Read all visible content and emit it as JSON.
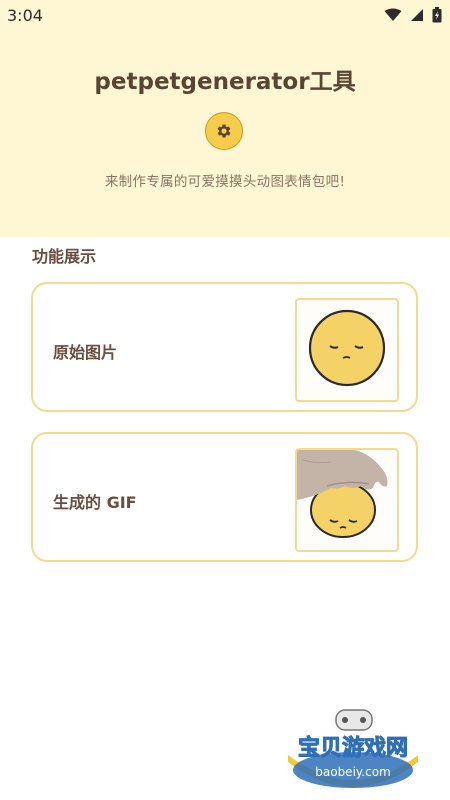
{
  "status_bar": {
    "time": "3:04"
  },
  "header": {
    "title": "petpetgenerator工具",
    "subtitle": "来制作专属的可爱摸摸头动图表情包吧!"
  },
  "section": {
    "title": "功能展示"
  },
  "cards": [
    {
      "label": "原始图片",
      "image": "sleepy-face-icon"
    },
    {
      "label": "生成的 GIF",
      "image": "hand-petting-face-image"
    }
  ],
  "watermark": {
    "brand": "宝贝游戏网",
    "site": "baobeiy.com"
  },
  "colors": {
    "header_bg": "#fff6d4",
    "accent": "#f7cc4a",
    "card_border": "#f5d98f",
    "text_brown": "#5b4433"
  }
}
